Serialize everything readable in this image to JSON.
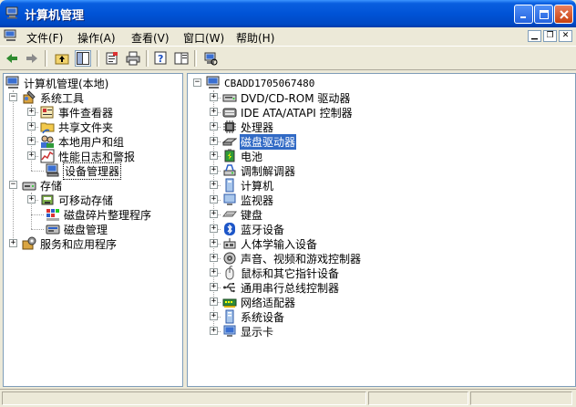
{
  "window": {
    "title": "计算机管理"
  },
  "menu": [
    "文件(F)",
    "操作(A)",
    "查看(V)",
    "窗口(W)",
    "帮助(H)"
  ],
  "tree": [
    {
      "label": "计算机管理(本地)",
      "icon": "computer-management-icon"
    },
    {
      "label": "系统工具",
      "icon": "system-tools-icon"
    },
    {
      "label": "事件查看器",
      "icon": "event-viewer-icon"
    },
    {
      "label": "共享文件夹",
      "icon": "shared-folders-icon"
    },
    {
      "label": "本地用户和组",
      "icon": "users-groups-icon"
    },
    {
      "label": "性能日志和警报",
      "icon": "performance-logs-icon"
    },
    {
      "label": "设备管理器",
      "icon": "device-manager-icon"
    },
    {
      "label": "存储",
      "icon": "storage-icon"
    },
    {
      "label": "可移动存储",
      "icon": "removable-storage-icon"
    },
    {
      "label": "磁盘碎片整理程序",
      "icon": "defragmenter-icon"
    },
    {
      "label": "磁盘管理",
      "icon": "disk-management-icon"
    },
    {
      "label": "服务和应用程序",
      "icon": "services-apps-icon"
    }
  ],
  "devices": {
    "root": "CBADD1705067480",
    "items": [
      {
        "label": "DVD/CD-ROM 驱动器",
        "icon": "dvd-drive-icon"
      },
      {
        "label": "IDE ATA/ATAPI 控制器",
        "icon": "ide-controller-icon"
      },
      {
        "label": "处理器",
        "icon": "processor-icon"
      },
      {
        "label": "磁盘驱动器",
        "icon": "disk-drive-icon"
      },
      {
        "label": "电池",
        "icon": "battery-icon"
      },
      {
        "label": "调制解调器",
        "icon": "modem-icon"
      },
      {
        "label": "计算机",
        "icon": "computer-icon"
      },
      {
        "label": "监视器",
        "icon": "monitor-icon"
      },
      {
        "label": "键盘",
        "icon": "keyboard-icon"
      },
      {
        "label": "蓝牙设备",
        "icon": "bluetooth-icon"
      },
      {
        "label": "人体学输入设备",
        "icon": "hid-icon"
      },
      {
        "label": "声音、视频和游戏控制器",
        "icon": "sound-icon"
      },
      {
        "label": "鼠标和其它指针设备",
        "icon": "mouse-icon"
      },
      {
        "label": "通用串行总线控制器",
        "icon": "usb-icon"
      },
      {
        "label": "网络适配器",
        "icon": "network-adapter-icon"
      },
      {
        "label": "系统设备",
        "icon": "system-devices-icon"
      },
      {
        "label": "显示卡",
        "icon": "display-adapter-icon"
      }
    ]
  }
}
